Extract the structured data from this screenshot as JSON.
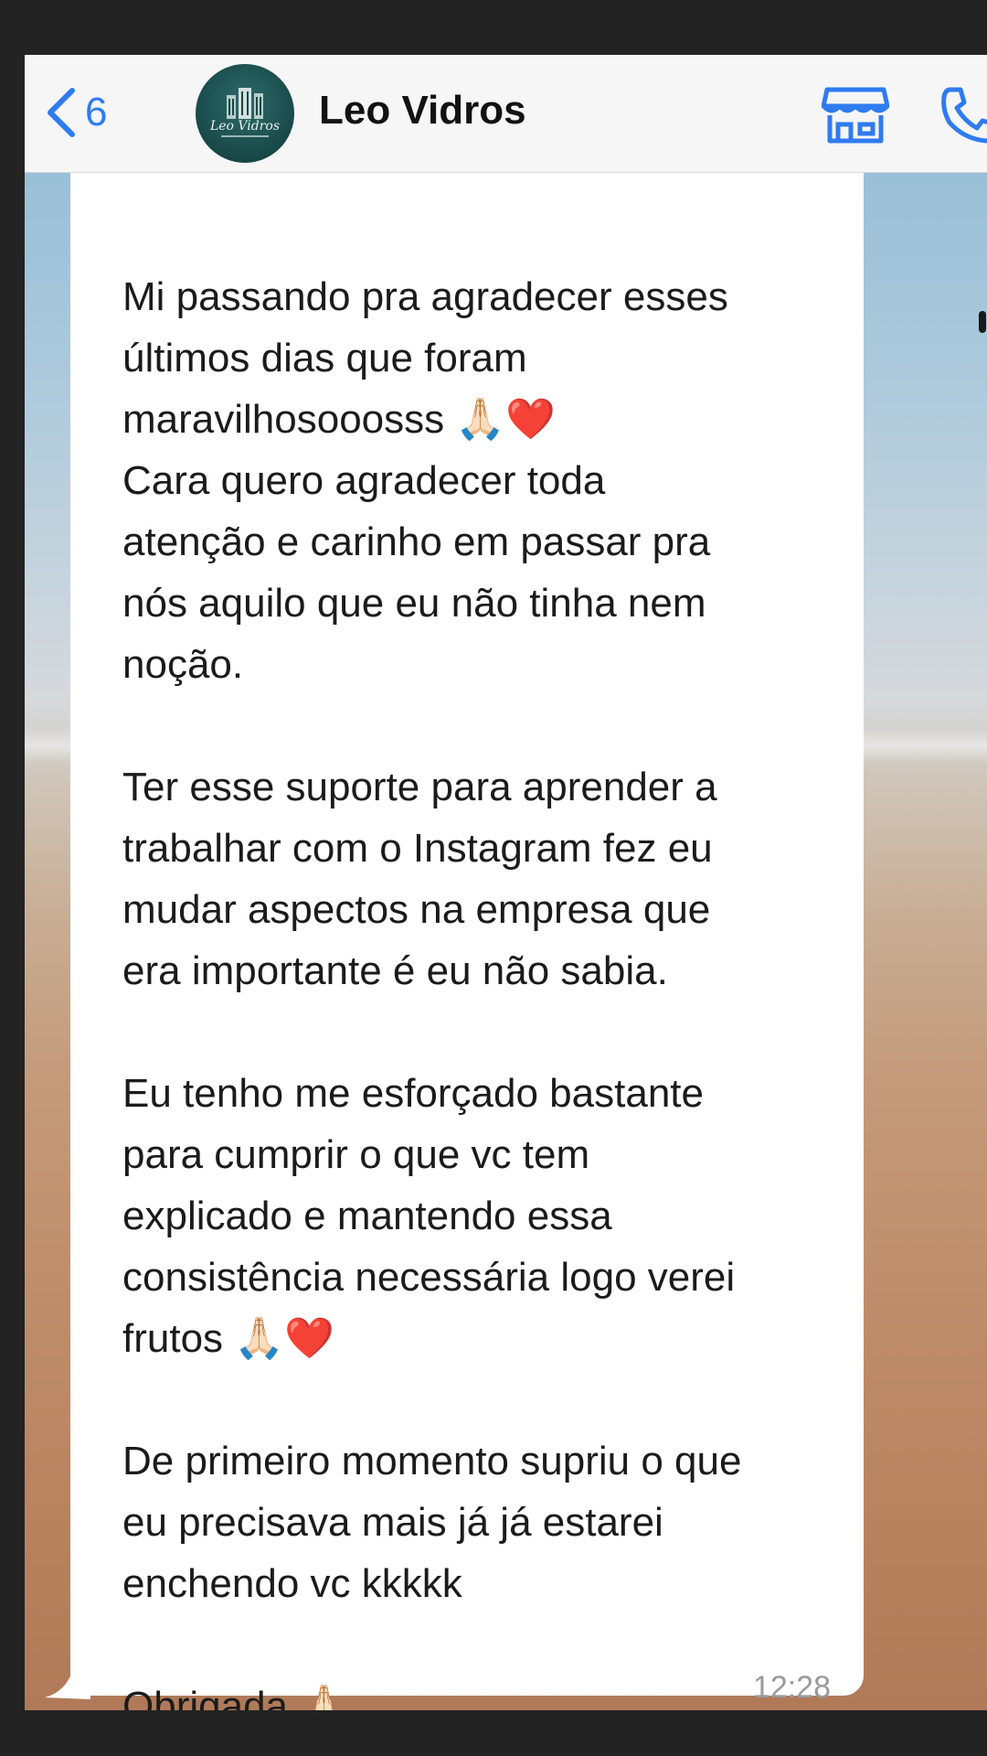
{
  "header": {
    "back_count": "6",
    "contact_name": "Leo Vidros",
    "avatar_text": "Leo Vidros"
  },
  "message": {
    "text": "Mi passando pra agradecer esses\núltimos dias que foram\nmaravilhosooosss 🙏🏻❤️\nCara quero agradecer toda\natenção e carinho em passar pra\nnós aquilo que eu não tinha nem\nnoção.\n\nTer esse suporte para aprender a\ntrabalhar com o Instagram fez eu\nmudar aspectos na empresa que\nera importante é eu não sabia.\n\nEu tenho me esforçado bastante\npara cumprir o que vc tem\nexplicado e mantendo essa\nconsistência necessária logo verei\nfrutos 🙏🏻❤️\n\nDe primeiro momento supriu o que\neu precisava mais já já estarei\nenchendo vc kkkkk\n\nObrigada 🙏🏻",
    "time": "12:28"
  },
  "icons": {
    "back": "chevron-left-icon",
    "store": "store-icon",
    "call": "phone-icon"
  },
  "colors": {
    "accent": "#2f7bf0",
    "bubble": "#ffffff",
    "header": "#f6f6f6"
  }
}
